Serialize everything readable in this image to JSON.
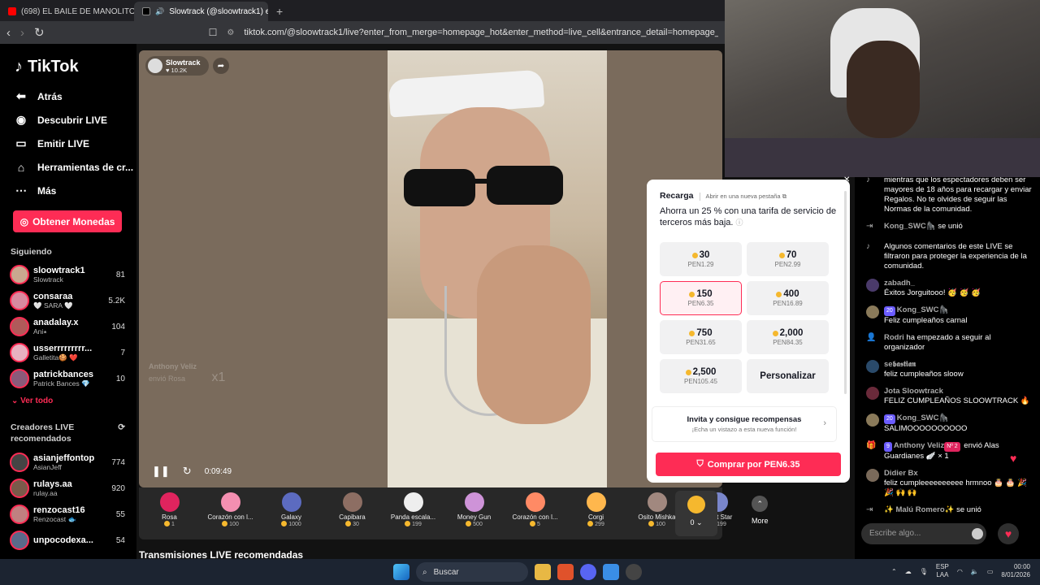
{
  "browser": {
    "tabs": [
      {
        "title": "(698) EL BAILE DE MANOLITO #viral",
        "active": false,
        "favicon_color": "#ff0000"
      },
      {
        "title": "Slowtrack (@sloowtrack1) e",
        "active": true,
        "favicon_color": "#000000"
      }
    ],
    "new_tab": "+",
    "url": "tiktok.com/@sloowtrack1/live?enter_from_merge=homepage_hot&enter_method=live_cell&entrance_detail=homepage_hot_live_cell&from_pl"
  },
  "sidebar": {
    "brand": "TikTok",
    "nav": [
      {
        "label": "Atrás",
        "icon": "arrow-left-icon"
      },
      {
        "label": "Descubrir LIVE",
        "icon": "live-discover-icon"
      },
      {
        "label": "Emitir LIVE",
        "icon": "camera-icon"
      },
      {
        "label": "Herramientas de cr...",
        "icon": "home-tools-icon"
      },
      {
        "label": "Más",
        "icon": "more-dots-icon"
      }
    ],
    "coins_button": "Obtener Monedas",
    "following_title": "Siguiendo",
    "following": [
      {
        "name": "sloowtrack1",
        "sub": "Slowtrack",
        "count": "81"
      },
      {
        "name": "consaraa",
        "sub": "🤍 SARA 🤍",
        "count": "5.2K"
      },
      {
        "name": "anadalay.x",
        "sub": "Ani⭑",
        "count": "104"
      },
      {
        "name": "usserrrrrrrrr...",
        "sub": "Galletita🍪 ❤️",
        "count": "7"
      },
      {
        "name": "patrickbances",
        "sub": "Patrick Bances 💎",
        "count": "10"
      }
    ],
    "see_all": "Ver todo",
    "recommended_title": "Creadores LIVE recomendados",
    "recommended": [
      {
        "name": "asianjeffontop",
        "sub": "AsianJeff",
        "count": "774"
      },
      {
        "name": "rulays.aa",
        "sub": "rulay.aa",
        "count": "920"
      },
      {
        "name": "renzocast16",
        "sub": "Renzocast 🐟",
        "count": "55"
      },
      {
        "name": "unpocodexa...",
        "sub": "",
        "count": "54"
      }
    ]
  },
  "stream": {
    "host_name": "Slowtrack",
    "host_likes": "♥ 10.2K",
    "ghost_user": "Anthony Veliz",
    "ghost_text": "envió Rosa",
    "ghost_count": "x1",
    "time": "0:09:49",
    "recommended_title": "Transmisiones LIVE recomendadas"
  },
  "gifts": [
    {
      "name": "Rosa",
      "price": "1",
      "color": "#e0245e"
    },
    {
      "name": "Corazón con l...",
      "price": "100",
      "color": "#f48fb1"
    },
    {
      "name": "Galaxy",
      "price": "1000",
      "color": "#5c6bc0"
    },
    {
      "name": "Capibara",
      "price": "30",
      "color": "#8d6e63"
    },
    {
      "name": "Panda escala...",
      "price": "199",
      "color": "#eeeeee"
    },
    {
      "name": "Money Gun",
      "price": "500",
      "color": "#ce93d8"
    },
    {
      "name": "Corazón con l...",
      "price": "5",
      "color": "#ff8a65"
    },
    {
      "name": "Corgi",
      "price": "299",
      "color": "#ffb74d"
    },
    {
      "name": "Osito Mishka",
      "price": "100",
      "color": "#a1887f"
    },
    {
      "name": "Night Star",
      "price": "199",
      "color": "#7986cb"
    }
  ],
  "gift_more": "More",
  "wallet_balance": "0",
  "recharge": {
    "title": "Recarga",
    "link": "Abrir en una nueva pestaña",
    "desc": "Ahorra un 25 % con una tarifa de servicio de terceros más baja.",
    "packages": [
      {
        "coins": "30",
        "price": "PEN1.29",
        "selected": false
      },
      {
        "coins": "70",
        "price": "PEN2.99",
        "selected": false
      },
      {
        "coins": "150",
        "price": "PEN6.35",
        "selected": true
      },
      {
        "coins": "400",
        "price": "PEN16.89",
        "selected": false
      },
      {
        "coins": "750",
        "price": "PEN31.65",
        "selected": false
      },
      {
        "coins": "2,000",
        "price": "PEN84.35",
        "selected": false
      },
      {
        "coins": "2,500",
        "price": "PEN105.45",
        "selected": false
      }
    ],
    "custom": "Personalizar",
    "invite_title": "Invita y consigue recompensas",
    "invite_sub": "¡Echa un vistazo a esta nueva función!",
    "buy": "Comprar por PEN6.35"
  },
  "chat": {
    "messages": [
      {
        "user": "",
        "badge": "",
        "text": "mientras que los espectadores deben ser mayores de 18 años para recargar y enviar Regalos. No te olvides de seguir las Normas de la comunidad.",
        "avatar": "system"
      },
      {
        "user": "Kong_SWC🦍",
        "badge": "",
        "text": "se unió",
        "avatar": "join"
      },
      {
        "user": "",
        "badge": "",
        "text": "Algunos comentarios de este LIVE se filtraron para proteger la experiencia de la comunidad.",
        "avatar": "system"
      },
      {
        "user": "zabadh_",
        "badge": "",
        "text": "Éxitos Jorguitooo! 🥳 🥳 🥳",
        "avatar": "#4a3a6a"
      },
      {
        "user": "Kong_SWC🦍",
        "badge": "20",
        "text": "Feliz cumpleaños carnal",
        "avatar": "#8a7a5a"
      },
      {
        "user": "Rodri",
        "badge": "",
        "text": "ha empezado a seguir al organizador",
        "avatar": "follow"
      },
      {
        "user": "se𝖇𝖆𝖘𝖙𝖎𝖆𝖓",
        "badge": "",
        "text": "feliz cumpleaños sloow",
        "avatar": "#2a4a6a"
      },
      {
        "user": "Jota Sloowtrack",
        "badge": "",
        "text": "FELIZ CUMPLEAÑOS SLOOWTRACK 🔥",
        "avatar": "#6a2a3a"
      },
      {
        "user": "Kong_SWC🦍",
        "badge": "20",
        "text": "SALIMOOOOOOOOOO",
        "avatar": "#8a7a5a"
      },
      {
        "user": "Anthony Veliz",
        "badge": "9",
        "badge2": "Nº 2",
        "text": "envió Alas Guardianes 🪽 × 1",
        "avatar": "gift"
      },
      {
        "user": "Didier Bx",
        "badge": "",
        "text": "feliz cumpleeeeeeeeee hrmnoo 🎂 🎂 🎉 🎉 🙌 🙌",
        "avatar": "#7a6a5a"
      },
      {
        "user": "✨ Malú Romero✨",
        "badge": "",
        "text": "se unió",
        "avatar": "join"
      }
    ],
    "placeholder": "Escribe algo..."
  },
  "taskbar": {
    "search": "Buscar",
    "lang_top": "ESP",
    "lang_bottom": "LAA",
    "time": "00:00",
    "date": "8/01/2026"
  },
  "colors": {
    "accent": "#fe2c55",
    "coin": "#f5b82e"
  }
}
